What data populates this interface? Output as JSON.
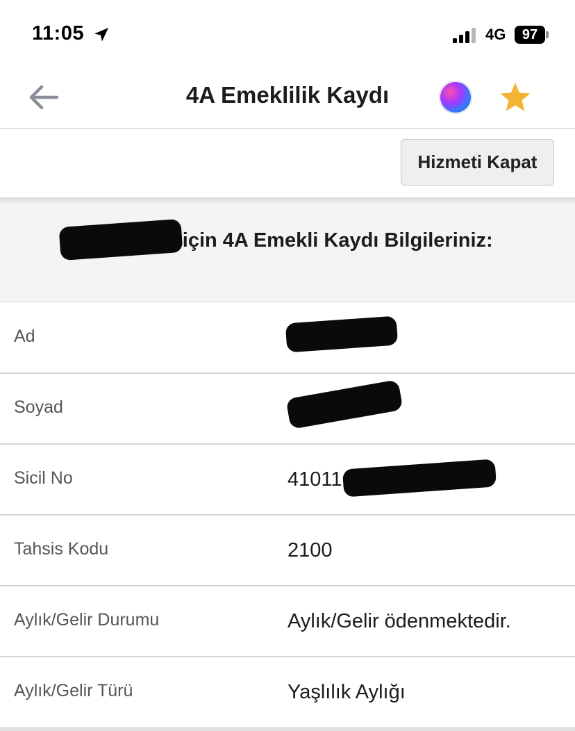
{
  "status_bar": {
    "time": "11:05",
    "network": "4G",
    "battery": "97"
  },
  "nav": {
    "title": "4A Emeklilik Kaydı",
    "icons": [
      "back-arrow-icon",
      "siri-icon",
      "star-icon"
    ],
    "star_color": "#f5b334"
  },
  "actions": {
    "close_service_label": "Hizmeti Kapat"
  },
  "info_header": {
    "text": "Tahsis No için 4A Emekli Kaydı Bilgileriniz:"
  },
  "rows": [
    {
      "label": "Ad",
      "value": ""
    },
    {
      "label": "Soyad",
      "value": ""
    },
    {
      "label": "Sicil No",
      "value": "41011"
    },
    {
      "label": "Tahsis Kodu",
      "value": "2100"
    },
    {
      "label": "Aylık/Gelir Durumu",
      "value": "Aylık/Gelir ödenmektedir."
    },
    {
      "label": "Aylık/Gelir Türü",
      "value": "Yaşlılık Aylığı"
    }
  ]
}
